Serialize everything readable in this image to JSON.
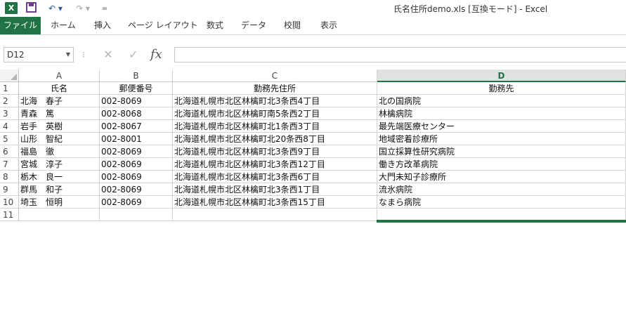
{
  "titlebar": {
    "title": "氏名住所demo.xls  [互換モード] - Excel",
    "excel_icon_label": "X",
    "undo_glyph": "↶ ▾",
    "redo_glyph": "↷ ▾",
    "customize_glyph": "="
  },
  "ribbon": {
    "tabs": [
      "ファイル",
      "ホーム",
      "挿入",
      "ページ レイアウト",
      "数式",
      "データ",
      "校閲",
      "表示"
    ]
  },
  "formula_bar": {
    "name_box": "D12",
    "dropdown_glyph": "▼",
    "separator_glyph": "⁝",
    "cancel_glyph": "✕",
    "enter_glyph": "✓",
    "fx_label": "fx",
    "formula_value": ""
  },
  "sheet": {
    "columns": [
      "A",
      "B",
      "C",
      "D"
    ],
    "selected_column": "D",
    "row_numbers": [
      "1",
      "2",
      "3",
      "4",
      "5",
      "6",
      "7",
      "8",
      "9",
      "10",
      "11"
    ],
    "header": [
      "氏名",
      "郵便番号",
      "勤務先住所",
      "勤務先"
    ],
    "rows": [
      [
        "北海　春子",
        "002-8069",
        "北海道札幌市北区林檎町北3条西4丁目",
        "北の国病院"
      ],
      [
        "青森　篤",
        "002-8068",
        "北海道札幌市北区林檎町南5条西2丁目",
        "林檎病院"
      ],
      [
        "岩手　英樹",
        "002-8067",
        "北海道札幌市北区林檎町北1条西3丁目",
        "最先端医療センター"
      ],
      [
        "山形　智紀",
        "002-8001",
        "北海道札幌市北区林檎町北20条西8丁目",
        "地域密着診療所"
      ],
      [
        "福島　徹",
        "002-8069",
        "北海道札幌市北区林檎町北3条西9丁目",
        "国立採算性研究病院"
      ],
      [
        "宮城　淳子",
        "002-8069",
        "北海道札幌市北区林檎町北3条西12丁目",
        "働き方改革病院"
      ],
      [
        "栃木　良一",
        "002-8069",
        "北海道札幌市北区林檎町北3条西6丁目",
        "大門未知子診療所"
      ],
      [
        "群馬　和子",
        "002-8069",
        "北海道札幌市北区林檎町北3条西1丁目",
        "流氷病院"
      ],
      [
        "埼玉　恒明",
        "002-8069",
        "北海道札幌市北区林檎町北3条西15丁目",
        "なまら病院"
      ],
      [
        "",
        "",
        "",
        ""
      ]
    ]
  },
  "colors": {
    "excel_green": "#217346",
    "save_purple": "#6b3e8c"
  }
}
